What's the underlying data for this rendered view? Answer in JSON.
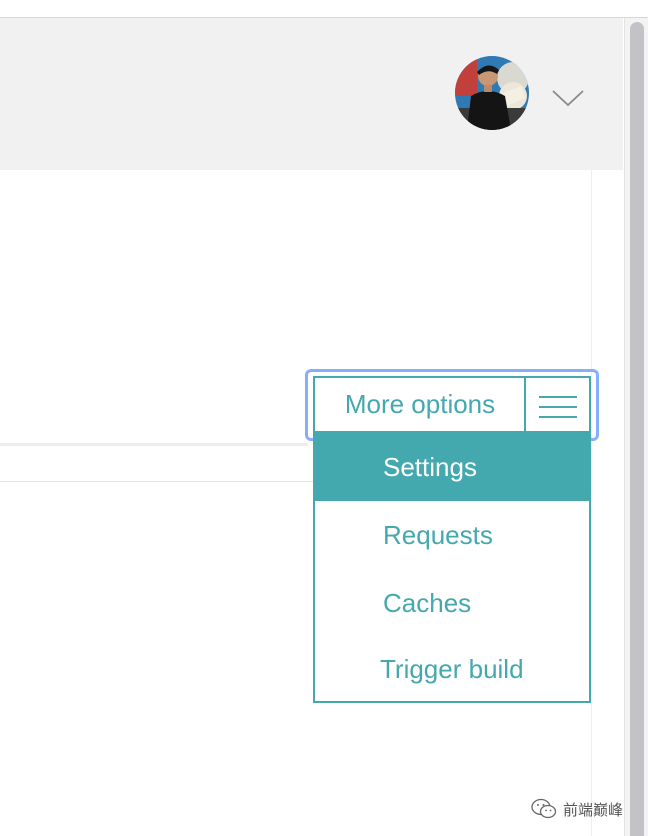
{
  "header": {
    "avatar_alt": "user avatar",
    "chevron_icon": "chevron-down-icon"
  },
  "menu": {
    "more_options_label": "More options",
    "toggle_icon": "hamburger-menu-icon",
    "items": [
      {
        "label": "Settings",
        "active": true
      },
      {
        "label": "Requests",
        "active": false
      },
      {
        "label": "Caches",
        "active": false
      },
      {
        "label": "Trigger build",
        "active": false
      }
    ]
  },
  "watermark": {
    "text": "前端巅峰",
    "icon": "wechat-icon"
  },
  "colors": {
    "accent": "#44a9af",
    "header_bg": "#f1f1f1",
    "focus_ring": "#87aef8",
    "scrollbar_thumb": "#c3c3c7"
  }
}
